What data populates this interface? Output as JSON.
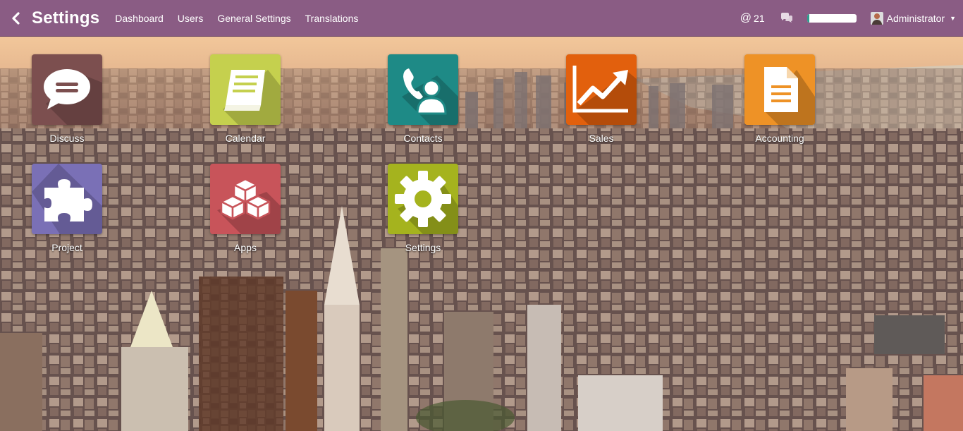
{
  "navbar": {
    "title": "Settings",
    "menu": [
      "Dashboard",
      "Users",
      "General Settings",
      "Translations"
    ],
    "mentions_count": "21",
    "progress": 0.05,
    "user_name": "Administrator"
  },
  "apps": [
    {
      "label": "Discuss",
      "color": "#7c4f4f",
      "icon": "chat-bubble-icon"
    },
    {
      "label": "Calendar",
      "color": "#c5d04e",
      "icon": "book-icon"
    },
    {
      "label": "Contacts",
      "color": "#1e8a86",
      "icon": "contact-phone-icon"
    },
    {
      "label": "Sales",
      "color": "#e2600d",
      "icon": "trend-chart-icon"
    },
    {
      "label": "Accounting",
      "color": "#ee9226",
      "icon": "document-icon"
    },
    {
      "label": "Project",
      "color": "#7a70b6",
      "icon": "puzzle-icon"
    },
    {
      "label": "Apps",
      "color": "#c8545a",
      "icon": "cubes-icon"
    },
    {
      "label": "Settings",
      "color": "#a5b31e",
      "icon": "gear-icon"
    }
  ]
}
